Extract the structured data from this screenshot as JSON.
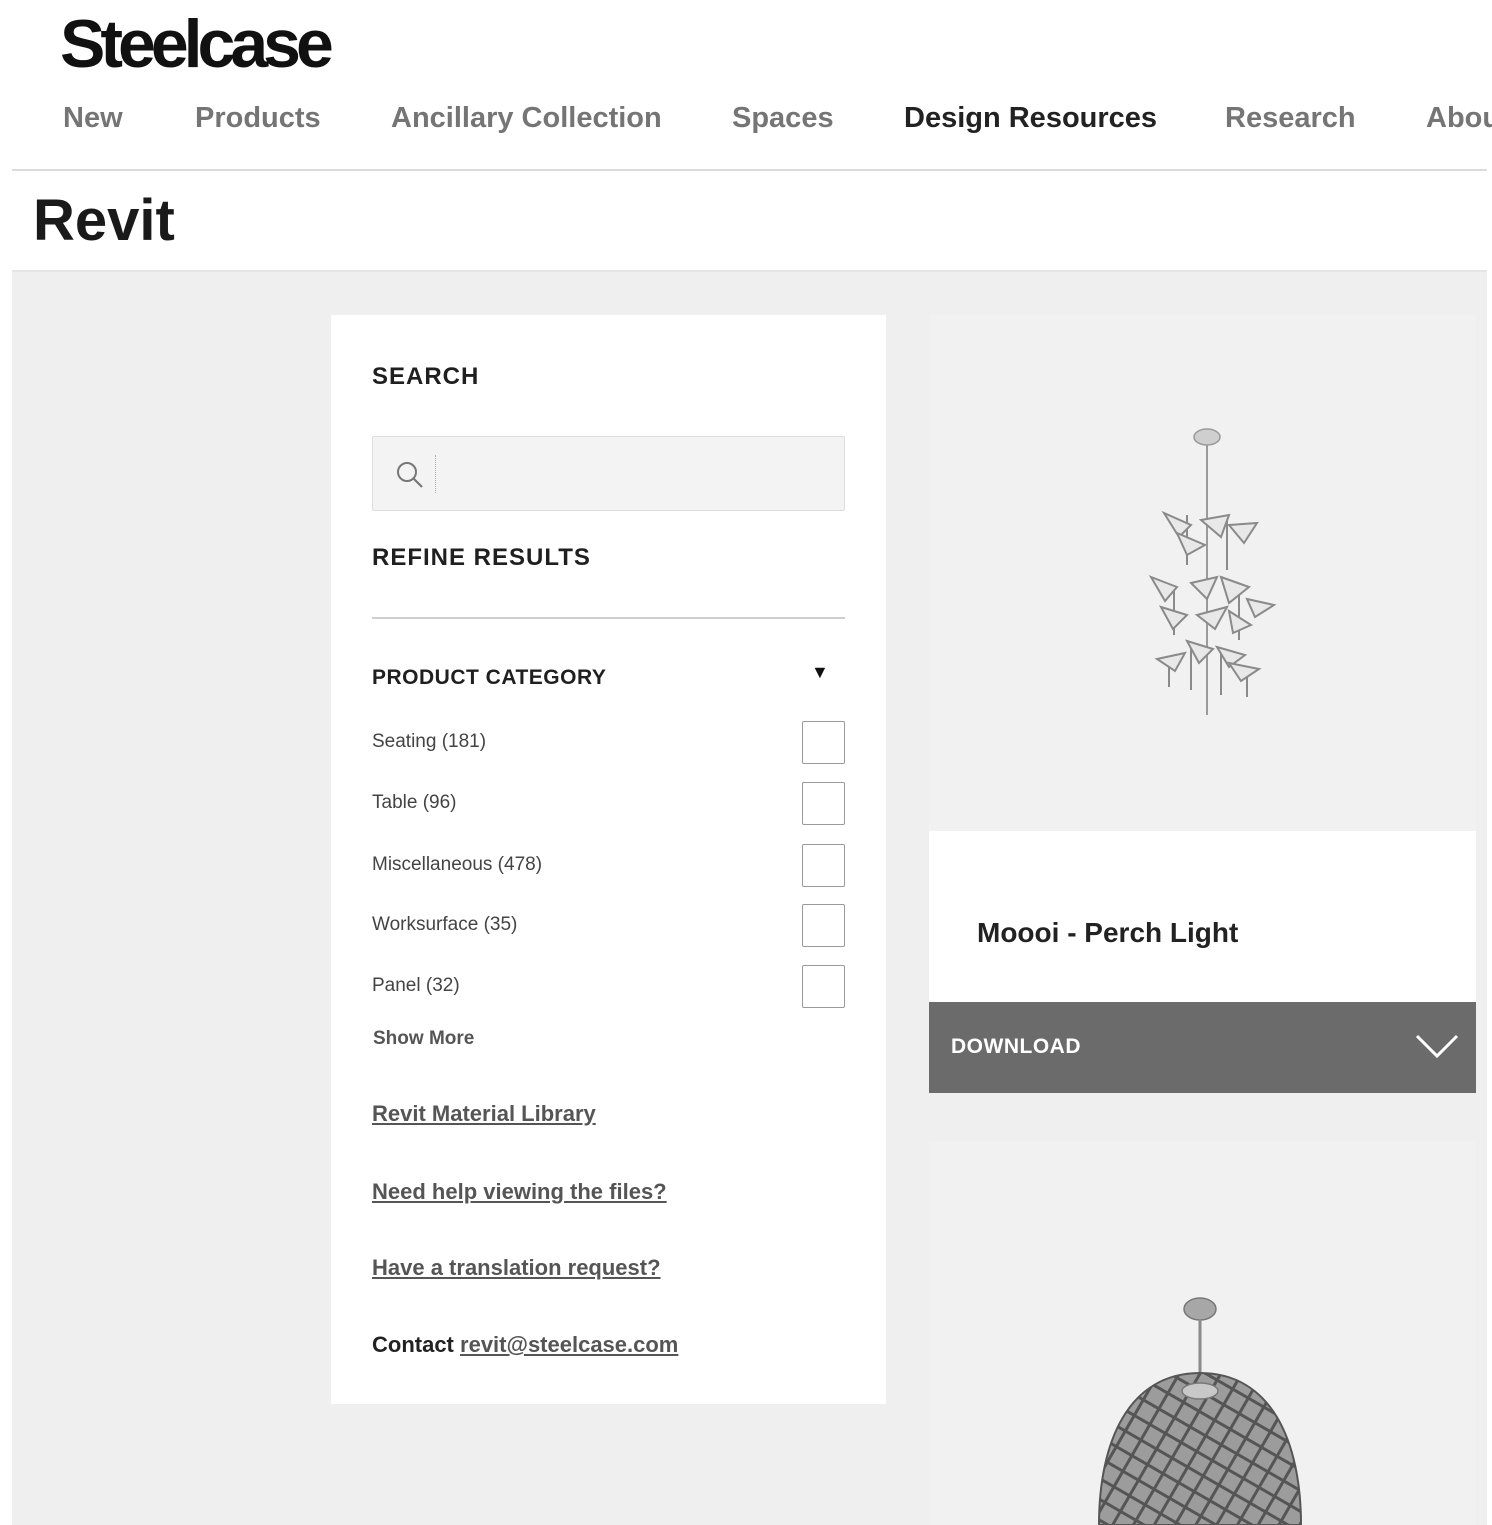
{
  "brand": {
    "logo_text": "Steelcase"
  },
  "nav": [
    {
      "label": "New",
      "active": false
    },
    {
      "label": "Products",
      "active": false
    },
    {
      "label": "Ancillary Collection",
      "active": false
    },
    {
      "label": "Spaces",
      "active": false
    },
    {
      "label": "Design Resources",
      "active": true
    },
    {
      "label": "Research",
      "active": false
    },
    {
      "label": "About",
      "active": false
    }
  ],
  "page": {
    "title": "Revit"
  },
  "sidebar": {
    "search_label": "SEARCH",
    "search_value": "",
    "search_icon": "search-icon",
    "refine_label": "REFINE RESULTS",
    "category_label": "PRODUCT CATEGORY",
    "category_toggle": "▼",
    "categories": [
      {
        "label": "Seating (181)",
        "checked": false
      },
      {
        "label": "Table (96)",
        "checked": false
      },
      {
        "label": "Miscellaneous (478)",
        "checked": false
      },
      {
        "label": "Worksurface (35)",
        "checked": false
      },
      {
        "label": "Panel (32)",
        "checked": false
      }
    ],
    "show_more": "Show More",
    "links": [
      "Revit Material Library",
      "Need help viewing the files?",
      "Have a translation request?"
    ],
    "contact_prefix": "Contact",
    "contact_email": "revit@steelcase.com"
  },
  "products": [
    {
      "name": "Moooi - Perch Light",
      "download_label": "DOWNLOAD",
      "icon": "chevron-down-icon"
    },
    {
      "name": "",
      "download_label": ""
    }
  ],
  "colors": {
    "accent_gray": "#6b6b6b",
    "page_bg": "#efefef",
    "nav_inactive": "#757575",
    "nav_active": "#222222"
  }
}
